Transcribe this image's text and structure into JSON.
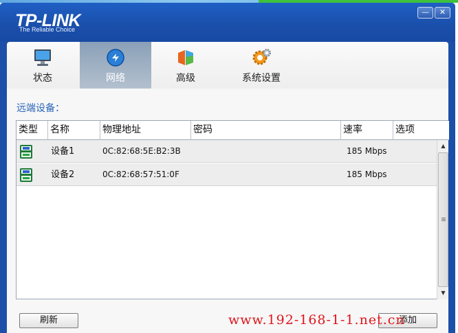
{
  "window": {
    "logo": "TP-LINK",
    "tagline": "The Reliable Choice",
    "minimize_glyph": "—",
    "close_glyph": "✕"
  },
  "tabs": [
    {
      "label": "状态",
      "icon": "monitor-icon",
      "active": false
    },
    {
      "label": "网络",
      "icon": "network-globe-icon",
      "active": true
    },
    {
      "label": "高级",
      "icon": "advanced-cube-icon",
      "active": false
    },
    {
      "label": "系统设置",
      "icon": "gear-icon",
      "active": false
    }
  ],
  "section_title": "远端设备：",
  "table": {
    "columns": [
      "类型",
      "名称",
      "物理地址",
      "密码",
      "速率",
      "选项"
    ],
    "rows": [
      {
        "type_icon": "powerline-adapter-icon",
        "name": "设备1",
        "mac": "0C:82:68:5E:B2:3B",
        "password": "",
        "rate": "185 Mbps",
        "options": ""
      },
      {
        "type_icon": "powerline-adapter-icon",
        "name": "设备2",
        "mac": "0C:82:68:57:51:0F",
        "password": "",
        "rate": "185 Mbps",
        "options": ""
      }
    ]
  },
  "buttons": {
    "refresh": "刷新",
    "add": "添加"
  },
  "watermark": "www.192-168-1-1.net.cn",
  "colors": {
    "titlebar": "#1a4fab",
    "accent_text": "#2a64b8",
    "watermark": "#e0141b"
  }
}
